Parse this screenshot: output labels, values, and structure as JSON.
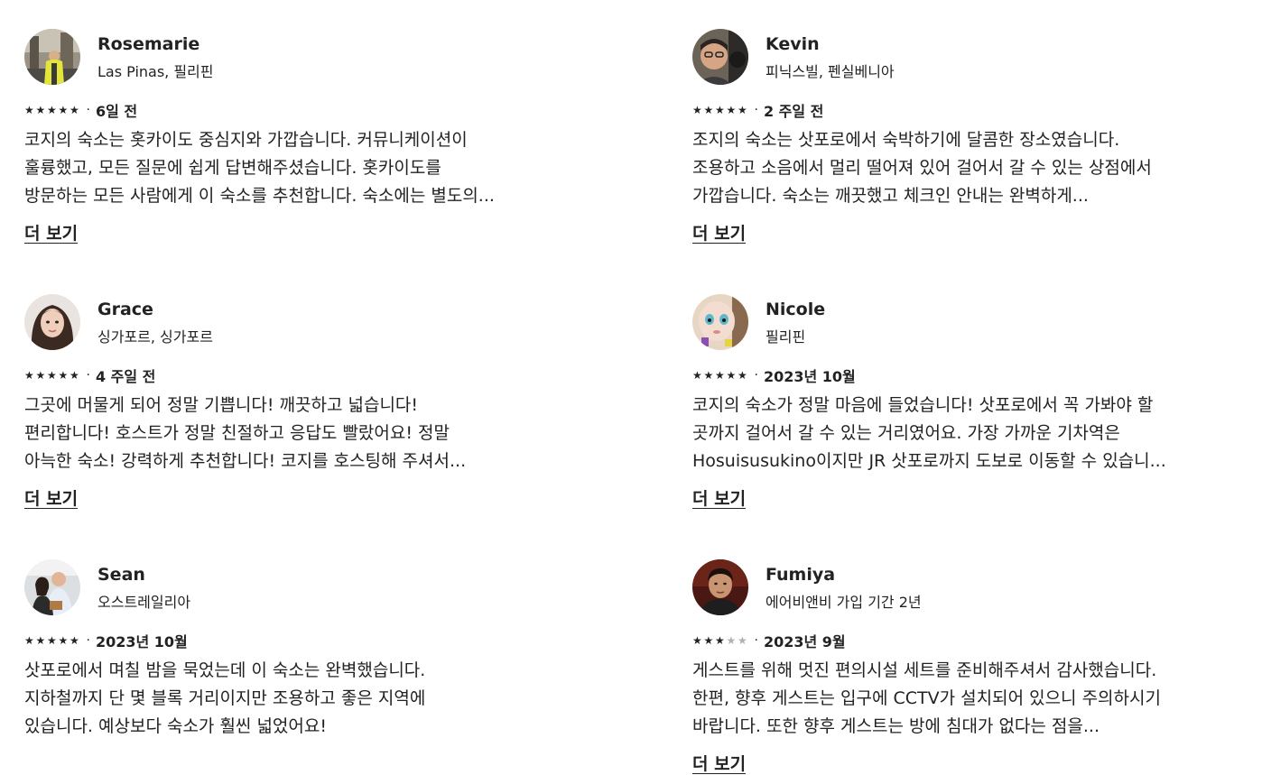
{
  "reviews": [
    {
      "name": "Rosemarie",
      "location": "Las Pinas, 필리핀",
      "rating": 5,
      "date": "6일 전",
      "lines": [
        "코지의 숙소는 홋카이도 중심지와 가깝습니다. 커뮤니케이션이",
        "훌륭했고, 모든 질문에 쉽게 답변해주셨습니다. 홋카이도를",
        "방문하는 모든 사람에게 이 숙소를 추천합니다. 숙소에는 별도의..."
      ],
      "more": "더 보기"
    },
    {
      "name": "Kevin",
      "location": "피닉스빌, 펜실베니아",
      "rating": 5,
      "date": "2 주일 전",
      "lines": [
        "조지의 숙소는 삿포로에서 숙박하기에 달콤한 장소였습니다.",
        "조용하고 소음에서 멀리 떨어져 있어 걸어서 갈 수 있는 상점에서",
        "가깝습니다. 숙소는 깨끗했고 체크인 안내는 완벽하게..."
      ],
      "more": "더 보기"
    },
    {
      "name": "Grace",
      "location": "싱가포르, 싱가포르",
      "rating": 5,
      "date": "4 주일 전",
      "lines": [
        "그곳에 머물게 되어 정말 기쁩니다! 깨끗하고 넓습니다!",
        "편리합니다! 호스트가 정말 친절하고 응답도 빨랐어요! 정말",
        "아늑한 숙소! 강력하게 추천합니다! 코지를 호스팅해 주셔서..."
      ],
      "more": "더 보기"
    },
    {
      "name": "Nicole",
      "location": "필리핀",
      "rating": 5,
      "date": "2023년 10월",
      "lines": [
        "코지의 숙소가 정말 마음에 들었습니다! 삿포로에서 꼭 가봐야 할",
        "곳까지 걸어서 갈 수 있는 거리였어요. 가장 가까운 기차역은",
        "Hosuisusukino이지만 JR 삿포로까지 도보로 이동할 수 있습니..."
      ],
      "more": "더 보기"
    },
    {
      "name": "Sean",
      "location": "오스트레일리아",
      "rating": 5,
      "date": "2023년 10월",
      "lines": [
        "삿포로에서 며칠 밤을 묵었는데 이 숙소는 완벽했습니다.",
        "지하철까지 단 몇 블록 거리이지만 조용하고 좋은 지역에",
        "있습니다. 예상보다 숙소가 훨씬 넓었어요!"
      ],
      "more": ""
    },
    {
      "name": "Fumiya",
      "location": "에어비앤비 가입 기간 2년",
      "rating": 3,
      "date": "2023년 9월",
      "lines": [
        "게스트를 위해 멋진 편의시설 세트를 준비해주셔서 감사했습니다.",
        "한편, 향후 게스트는 입구에 CCTV가 설치되어 있으니 주의하시기",
        "바랍니다. 또한 향후 게스트는 방에 침대가 없다는 점을..."
      ],
      "more": "더 보기"
    }
  ],
  "separator": "·",
  "colors": {
    "text": "#222222",
    "star_off": "#b0b0b0",
    "background": "#ffffff"
  }
}
